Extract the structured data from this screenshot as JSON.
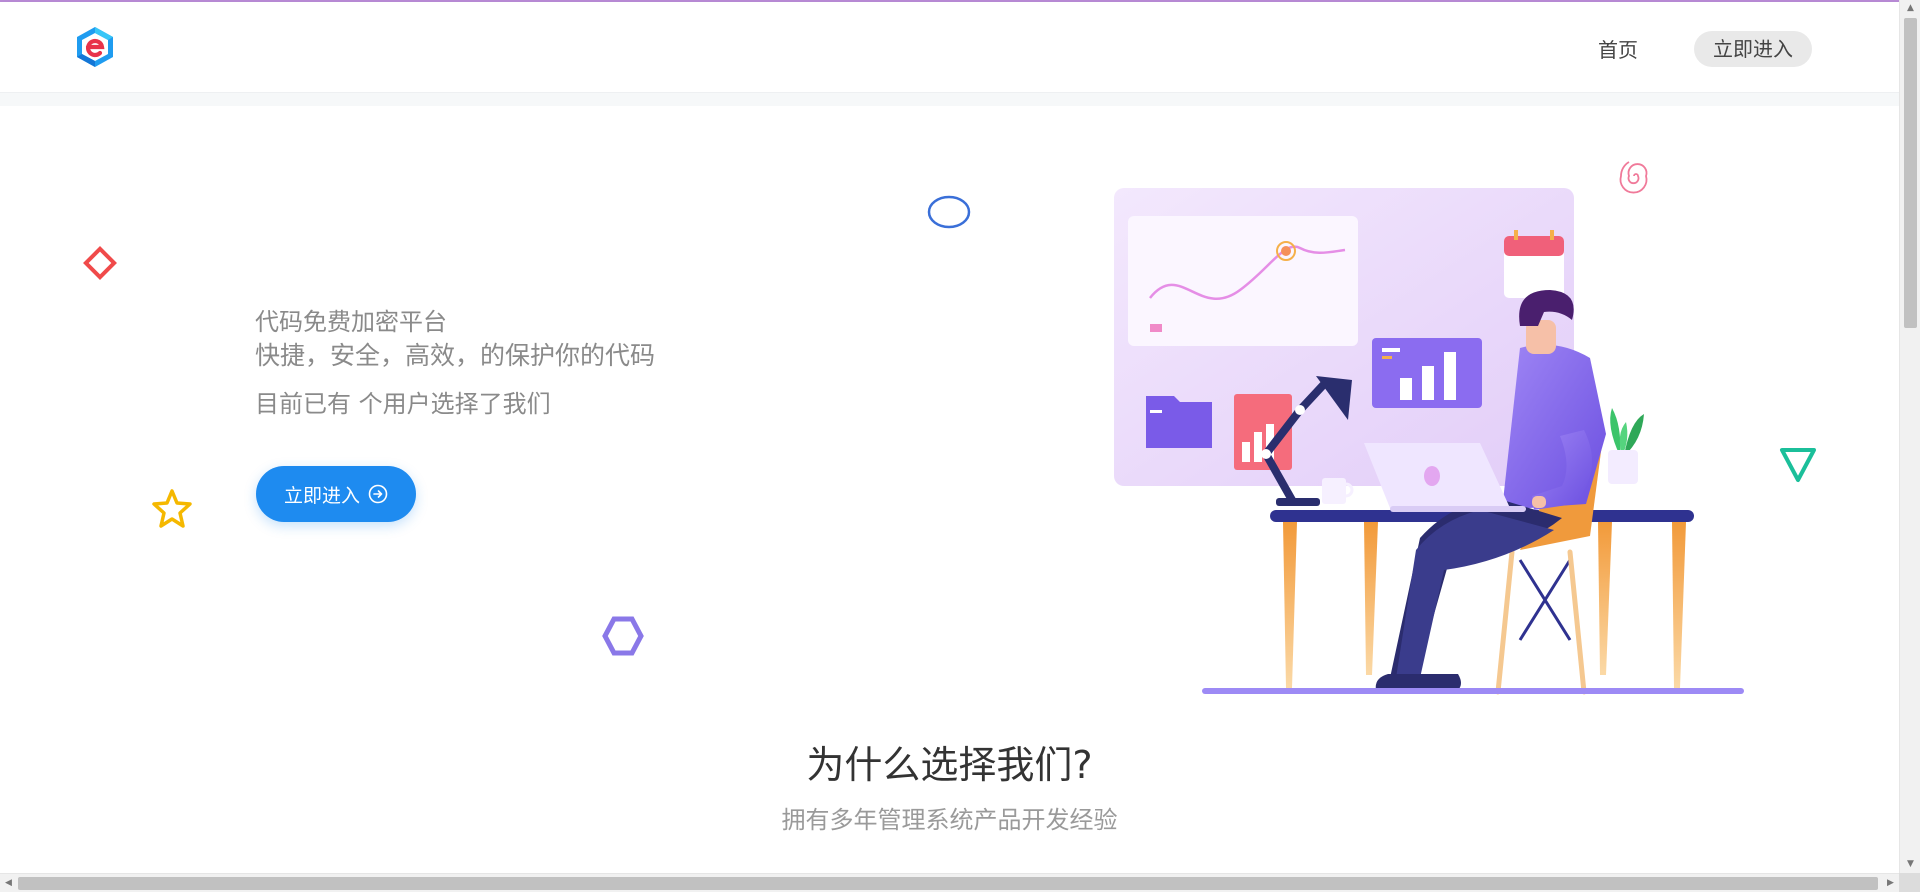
{
  "header": {
    "logo_icon": "e-cube-logo-icon",
    "nav_home": "首页",
    "nav_enter": "立即进入"
  },
  "hero": {
    "title": "代码免费加密平台",
    "subtitle": "快捷，安全，高效，的保护你的代码",
    "users_text": "目前已有 个用户选择了我们",
    "cta_label": "立即进入",
    "cta_icon": "arrow-right-circle-icon"
  },
  "why": {
    "title": "为什么选择我们?",
    "subtitle": "拥有多年管理系统产品开发经验"
  },
  "colors": {
    "accent": "#1e8bf0",
    "diamond": "#f04a4a",
    "star": "#f5b800",
    "hexagon": "#8a78e8",
    "ellipse": "#3a6fd8",
    "triangle": "#1bbf9a",
    "spiral": "#f07a9a"
  }
}
